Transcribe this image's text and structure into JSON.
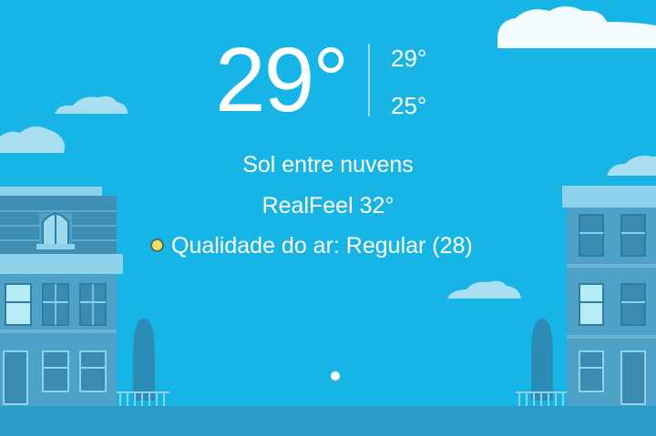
{
  "weather": {
    "current_temp": "29°",
    "high_temp": "29°",
    "low_temp": "25°",
    "condition": "Sol entre nuvens",
    "realfeel": "RealFeel 32°",
    "air_quality": "Qualidade do ar: Regular (28)"
  },
  "colors": {
    "sky": "#17b5e6",
    "building": "#4ea2c8",
    "ground": "#2b9cc5",
    "air_quality_indicator": "#f0e068"
  },
  "pagination": {
    "pages": 1,
    "active": 1
  }
}
